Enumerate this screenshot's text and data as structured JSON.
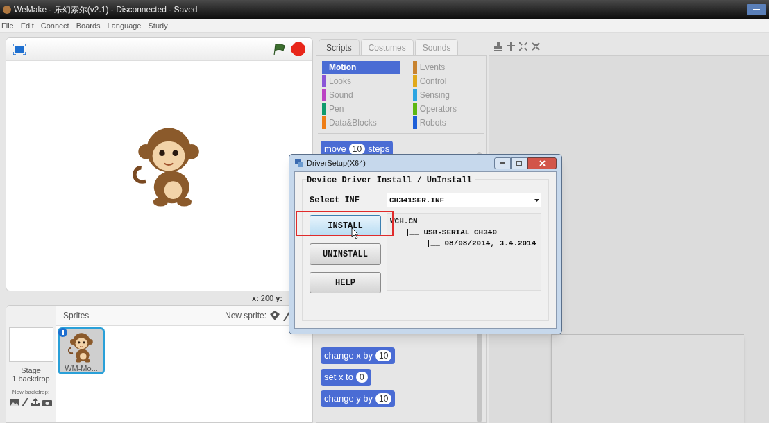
{
  "window": {
    "title": "WeMake - 乐幻索尔(v2.1) - Disconnected - Saved"
  },
  "menu": [
    "File",
    "Edit",
    "Connect",
    "Boards",
    "Language",
    "Study"
  ],
  "stage": {
    "x_label": "x:",
    "x_value": "200",
    "y_label": "y:"
  },
  "sprites_pane": {
    "title": "Sprites",
    "new_sprite_label": "New sprite:",
    "stage_label": "Stage",
    "backdrops": "1 backdrop",
    "new_backdrop_label": "New backdrop:",
    "sprites": [
      {
        "name": "WM-Mo...",
        "selected": true
      }
    ]
  },
  "tabs": [
    {
      "label": "Scripts",
      "selected": true
    },
    {
      "label": "Costumes",
      "selected": false
    },
    {
      "label": "Sounds",
      "selected": false
    }
  ],
  "categories": [
    {
      "label": "Motion",
      "color": "#4a6cd4",
      "selected": true
    },
    {
      "label": "Looks",
      "color": "#8a55d7",
      "selected": false
    },
    {
      "label": "Sound",
      "color": "#bb42c3",
      "selected": false
    },
    {
      "label": "Pen",
      "color": "#0e9a6c",
      "selected": false
    },
    {
      "label": "Data&Blocks",
      "color": "#ee7d16",
      "selected": false
    },
    {
      "label": "Events",
      "color": "#c88330",
      "selected": false
    },
    {
      "label": "Control",
      "color": "#e1a91a",
      "selected": false
    },
    {
      "label": "Sensing",
      "color": "#2ca5e2",
      "selected": false
    },
    {
      "label": "Operators",
      "color": "#5cb712",
      "selected": false
    },
    {
      "label": "Robots",
      "color": "#1d5fd8",
      "selected": false
    }
  ],
  "blocks_top": [
    {
      "parts": [
        {
          "kind": "text",
          "text": "move"
        },
        {
          "kind": "number",
          "text": "10"
        },
        {
          "kind": "text",
          "text": "steps"
        }
      ]
    }
  ],
  "blocks_bottom": [
    {
      "parts": [
        {
          "kind": "text",
          "text": "change x by"
        },
        {
          "kind": "number",
          "text": "10"
        }
      ]
    },
    {
      "parts": [
        {
          "kind": "text",
          "text": "set x to"
        },
        {
          "kind": "number",
          "text": "0"
        }
      ]
    },
    {
      "parts": [
        {
          "kind": "text",
          "text": "change y by"
        },
        {
          "kind": "number",
          "text": "10"
        }
      ]
    }
  ],
  "dialog": {
    "title": "DriverSetup(X64)",
    "heading": "Device Driver Install / UnInstall",
    "select_label": "Select INF",
    "select_value": "CH341SER.INF",
    "buttons": [
      {
        "label": "INSTALL",
        "highlighted": true
      },
      {
        "label": "UNINSTALL",
        "highlighted": false
      },
      {
        "label": "HELP",
        "highlighted": false
      }
    ],
    "tree": [
      {
        "text": "WCH.CN",
        "children": [
          {
            "text": "|__ USB-SERIAL CH340",
            "children": [
              {
                "text": "|__ 08/08/2014, 3.4.2014"
              }
            ]
          }
        ]
      }
    ]
  }
}
